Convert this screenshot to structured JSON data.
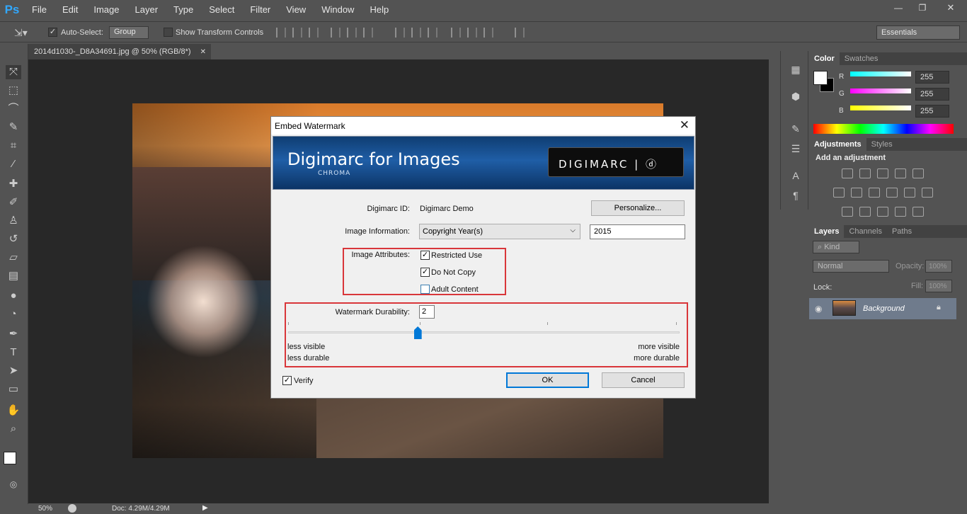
{
  "app": {
    "logo": "Ps"
  },
  "menu": [
    "File",
    "Edit",
    "Image",
    "Layer",
    "Type",
    "Select",
    "Filter",
    "View",
    "Window",
    "Help"
  ],
  "window_controls": {
    "minimize": "—",
    "restore": "❐",
    "close": "✕"
  },
  "options": {
    "auto_select_label": "Auto-Select:",
    "auto_select_value": "Group",
    "show_transform": "Show Transform Controls",
    "workspace": "Essentials"
  },
  "document": {
    "tab_title": "2014d1030-_D8A34691.jpg @ 50% (RGB/8*)",
    "tab_close": "✕"
  },
  "status": {
    "zoom": "50%",
    "doc": "Doc: 4.29M/4.29M"
  },
  "color_panel": {
    "tabs": [
      "Color",
      "Swatches"
    ],
    "r_label": "R",
    "g_label": "G",
    "b_label": "B",
    "r": "255",
    "g": "255",
    "b": "255"
  },
  "adjustments_panel": {
    "tabs": [
      "Adjustments",
      "Styles"
    ],
    "heading": "Add an adjustment"
  },
  "layers_panel": {
    "tabs": [
      "Layers",
      "Channels",
      "Paths"
    ],
    "kind": "Kind",
    "blend_mode": "Normal",
    "opacity_label": "Opacity:",
    "opacity": "100%",
    "lock_label": "Lock:",
    "fill_label": "Fill:",
    "fill": "100%",
    "layer_name": "Background"
  },
  "dialog": {
    "title": "Embed Watermark",
    "close": "✕",
    "banner_title": "Digimarc for Images",
    "banner_subtitle": "CHROMA",
    "banner_logo": "DIGIMARC | ⓓ",
    "id_label": "Digimarc ID:",
    "id_value": "Digimarc Demo",
    "personalize": "Personalize...",
    "info_label": "Image Information:",
    "info_select": "Copyright Year(s)",
    "info_value": "2015",
    "attributes_label": "Image Attributes:",
    "attributes": [
      {
        "label": "Restricted Use",
        "checked": true
      },
      {
        "label": "Do Not Copy",
        "checked": true
      },
      {
        "label": "Adult Content",
        "checked": false
      }
    ],
    "durability_label": "Watermark Durability:",
    "durability_value": "2",
    "durability_min": 1,
    "durability_max": 4,
    "left_caption_1": "less visible",
    "left_caption_2": "less durable",
    "right_caption_1": "more visible",
    "right_caption_2": "more durable",
    "verify_label": "Verify",
    "verify_checked": true,
    "ok": "OK",
    "cancel": "Cancel"
  },
  "colors": {
    "accent": "#0078d7",
    "highlight_box": "#d9363a",
    "ps_blue": "#31a8ff"
  }
}
